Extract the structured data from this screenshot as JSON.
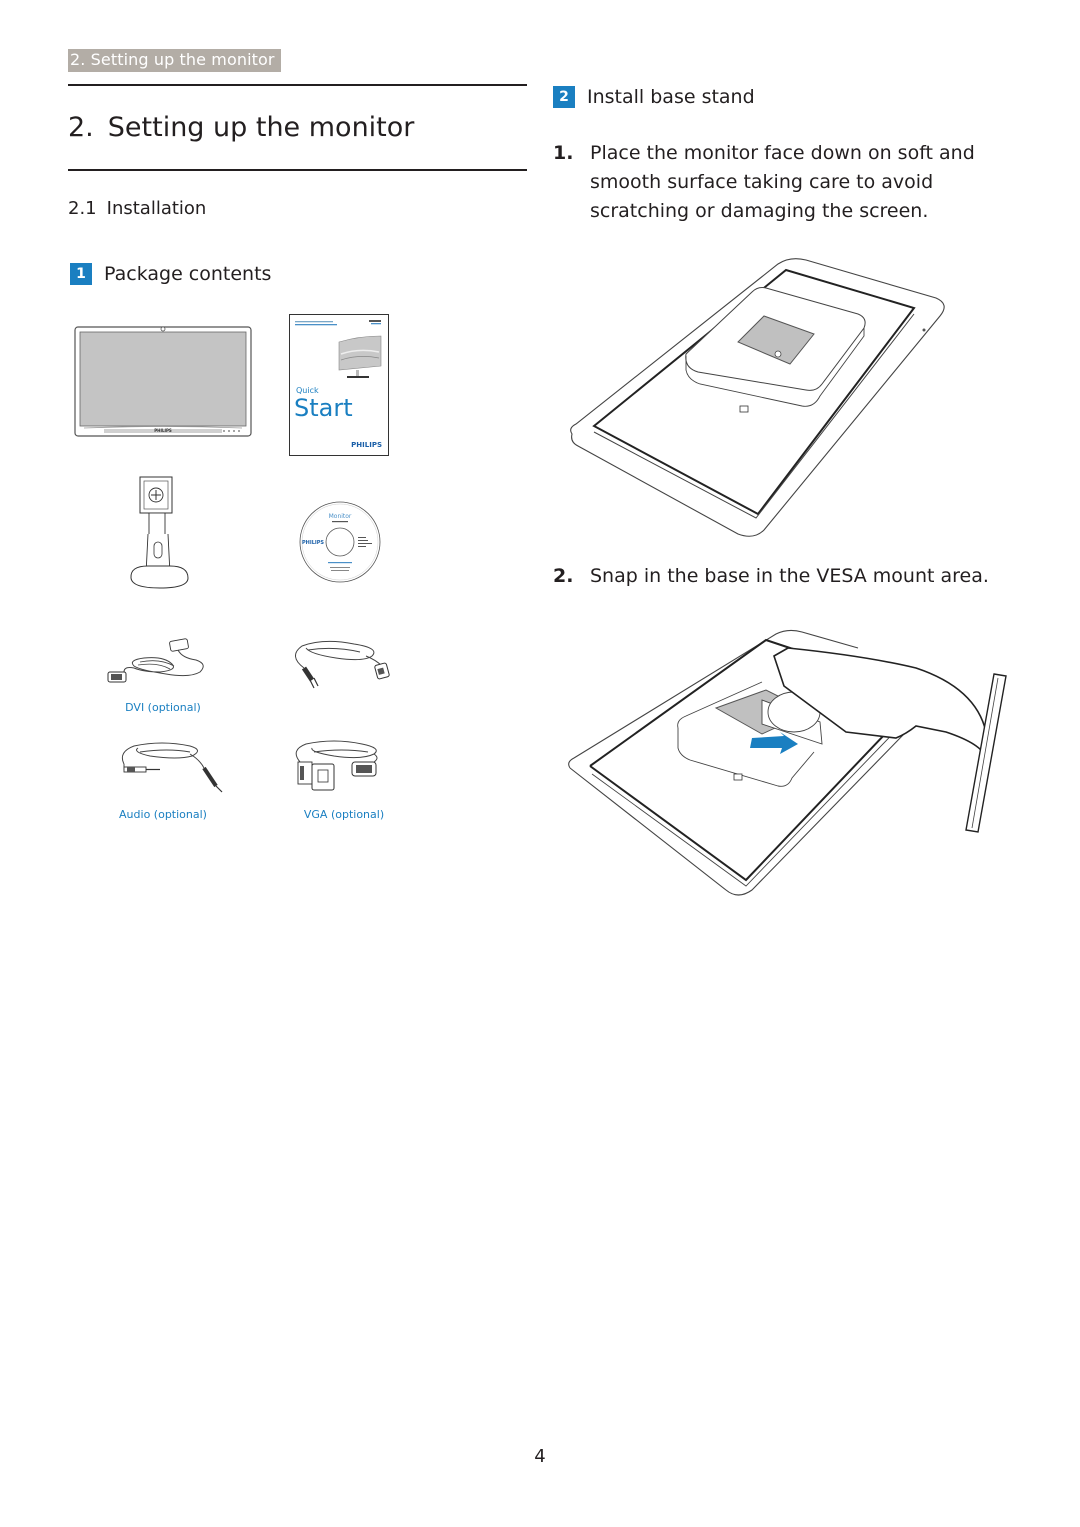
{
  "header": {
    "tag_label": "2. Setting up the monitor"
  },
  "section": {
    "number": "2.",
    "title": "Setting up the monitor"
  },
  "subsection": {
    "number": "2.1",
    "title": "Installation"
  },
  "package_contents": {
    "badge": "1",
    "heading": "Package contents",
    "items": [
      {
        "name": "Monitor",
        "caption": "",
        "brand": "PHILIPS"
      },
      {
        "name": "Quick Start guide",
        "caption": "",
        "small_label": "Quick",
        "big_label": "Start",
        "brand": "PHILIPS"
      },
      {
        "name": "Base stand",
        "caption": ""
      },
      {
        "name": "CD",
        "caption": "",
        "disc_title": "Monitor",
        "brand": "PHILIPS"
      },
      {
        "name": "DVI cable",
        "caption": "DVI (optional)"
      },
      {
        "name": "Power cable",
        "caption": ""
      },
      {
        "name": "Audio cable",
        "caption": "Audio (optional)"
      },
      {
        "name": "VGA cable",
        "caption": "VGA (optional)"
      }
    ]
  },
  "install_base": {
    "badge": "2",
    "heading": "Install base stand",
    "steps": [
      {
        "number": "1.",
        "text": "Place the monitor face down on soft and smooth surface taking care to avoid scratching or damaging the screen."
      },
      {
        "number": "2.",
        "text": "Snap in the base in the VESA mount area."
      }
    ]
  },
  "colors": {
    "accent_blue": "#1a7fc1",
    "header_tag_bg": "#b3ada6",
    "text": "#231f20"
  },
  "page_number": "4"
}
